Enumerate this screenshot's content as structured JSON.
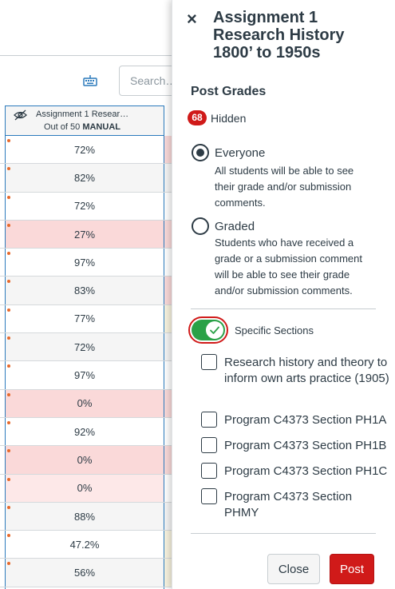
{
  "gradebook": {
    "search_placeholder": "Search…",
    "column": {
      "title": "Assignment 1 Resear…",
      "out_of": "Out of 50",
      "manual": "MANUAL"
    },
    "rows": [
      {
        "grade": "72%",
        "bg": "#ffffff",
        "next_bg": "#fad9d9"
      },
      {
        "grade": "82%",
        "bg": "#f5f5f5",
        "next_bg": "#f5f5f5"
      },
      {
        "grade": "72%",
        "bg": "#ffffff",
        "next_bg": "#ffffff"
      },
      {
        "grade": "27%",
        "bg": "#fad9d9",
        "next_bg": "#fad9d9"
      },
      {
        "grade": "97%",
        "bg": "#ffffff",
        "next_bg": "#ffffff"
      },
      {
        "grade": "83%",
        "bg": "#f5f5f5",
        "next_bg": "#fad9d9"
      },
      {
        "grade": "77%",
        "bg": "#ffffff",
        "next_bg": "#f8f3df"
      },
      {
        "grade": "72%",
        "bg": "#f5f5f5",
        "next_bg": "#f5f5f5"
      },
      {
        "grade": "97%",
        "bg": "#ffffff",
        "next_bg": "#ffffff"
      },
      {
        "grade": "0%",
        "bg": "#fad9d9",
        "next_bg": "#fad9d9"
      },
      {
        "grade": "92%",
        "bg": "#ffffff",
        "next_bg": "#ffffff"
      },
      {
        "grade": "0%",
        "bg": "#fad9d9",
        "next_bg": "#fad9d9"
      },
      {
        "grade": "0%",
        "bg": "#fde8e8",
        "next_bg": "#ffffff"
      },
      {
        "grade": "88%",
        "bg": "#f5f5f5",
        "next_bg": "#f5f5f5"
      },
      {
        "grade": "47.2%",
        "bg": "#ffffff",
        "next_bg": "#f8f3df"
      },
      {
        "grade": "56%",
        "bg": "#f5f5f5",
        "next_bg": "#f8f3df"
      }
    ]
  },
  "tray": {
    "title": "Assignment 1 Research History 1800’ to 1950s",
    "section_heading": "Post Grades",
    "hidden_count": "68",
    "hidden_label": "Hidden",
    "options": {
      "everyone": {
        "label": "Everyone",
        "description": "All students will be able to see their grade and/or submission comments.",
        "selected": true
      },
      "graded": {
        "label": "Graded",
        "description": "Students who have received a grade or a submission comment will be able to see their grade and/or submission comments.",
        "selected": false
      }
    },
    "specific_sections_label": "Specific Sections",
    "specific_sections_on": true,
    "sections": [
      {
        "label": "Research history and theory to inform own arts practice (1905)",
        "checked": false
      },
      {
        "label": "Program C4373 Section PH1A",
        "checked": false
      },
      {
        "label": "Program C4373 Section PH1B",
        "checked": false
      },
      {
        "label": "Program C4373 Section PH1C",
        "checked": false
      },
      {
        "label": "Program C4373 Section PHMY",
        "checked": false
      }
    ],
    "close_label": "Close",
    "post_label": "Post"
  },
  "colors": {
    "accent_red": "#d01a19",
    "toggle_green": "#2aa147",
    "text_dark": "#2d3b45",
    "column_focus_blue": "#2b7abc"
  }
}
